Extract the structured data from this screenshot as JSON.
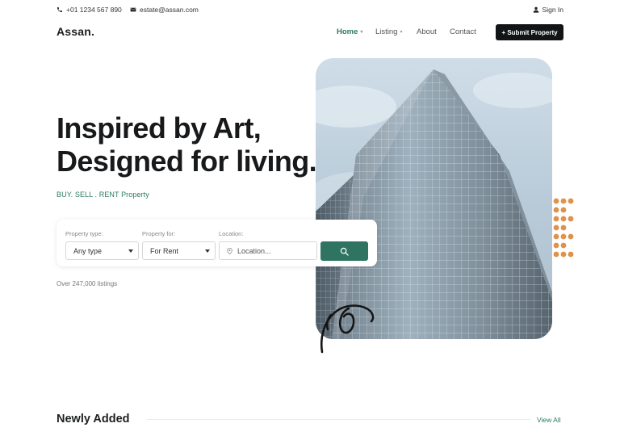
{
  "topbar": {
    "phone": "+01 1234 567 890",
    "email": "estate@assan.com",
    "sign_in": "Sign In"
  },
  "brand": {
    "logo": "Assan."
  },
  "nav": {
    "items": [
      {
        "label": "Home",
        "active": true,
        "has_dropdown": true
      },
      {
        "label": "Listing",
        "active": false,
        "has_dropdown": true
      },
      {
        "label": "About",
        "active": false,
        "has_dropdown": false
      },
      {
        "label": "Contact",
        "active": false,
        "has_dropdown": false
      }
    ],
    "submit_label": "+ Submit Property"
  },
  "hero": {
    "title_line1": "Inspired by Art,",
    "title_line2": "Designed for living.",
    "subtitle": "BUY. SELL . RENT Property"
  },
  "search": {
    "property_type_label": "Property type:",
    "property_type_value": "Any type",
    "property_for_label": "Property for:",
    "property_for_value": "For Rent",
    "location_label": "Location:",
    "location_placeholder": "Location..."
  },
  "listings_count": "Over 247,000 listings",
  "newly_added": {
    "title": "Newly Added",
    "view_all": "View All"
  },
  "colors": {
    "accent": "#2b7a5b",
    "search_button": "#2e7460",
    "dark_button": "#121416",
    "dots": "#e0914a"
  }
}
